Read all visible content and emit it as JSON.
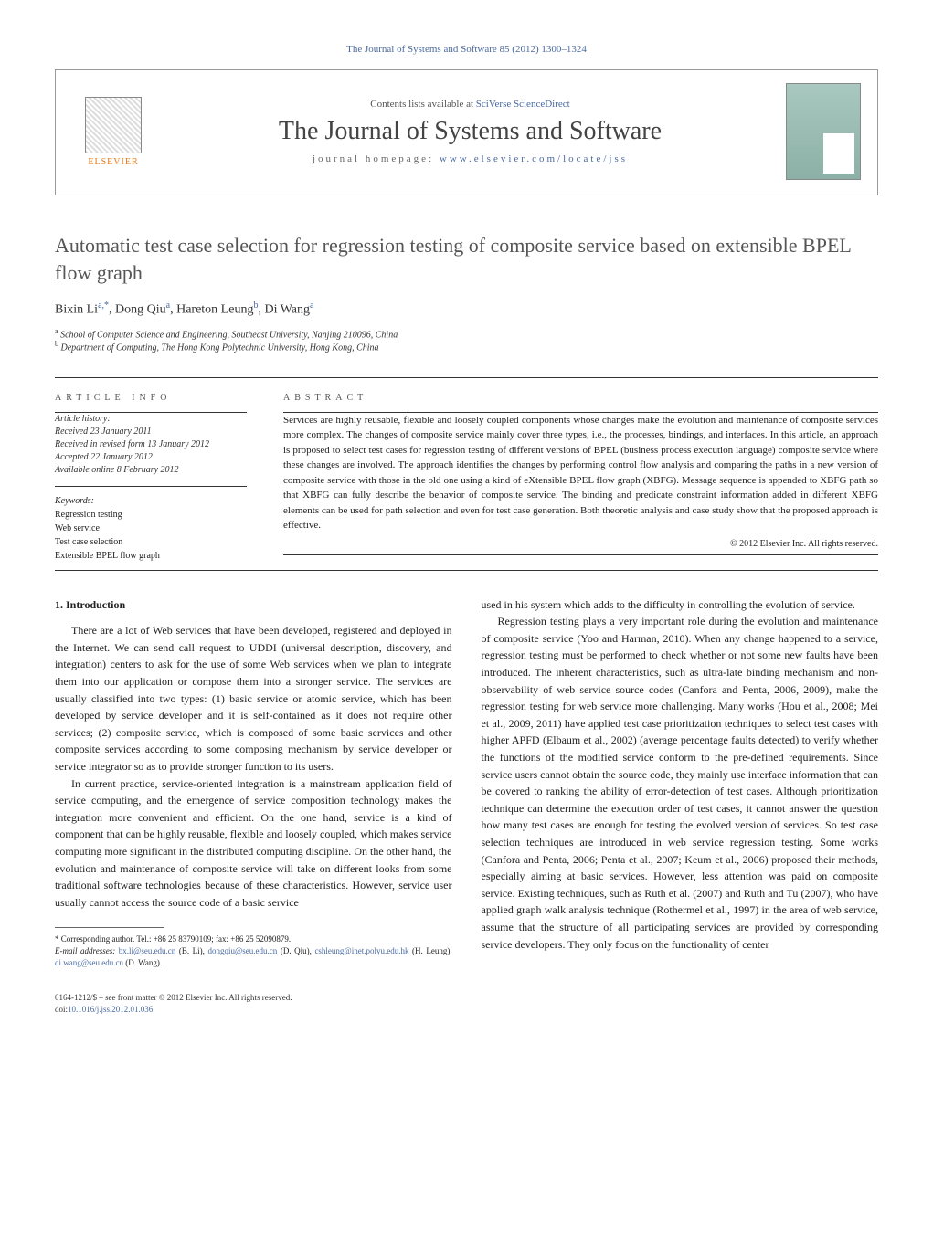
{
  "header": {
    "citation": "The Journal of Systems and Software 85 (2012) 1300–1324"
  },
  "journal_box": {
    "publisher_logo_text": "ELSEVIER",
    "contents_prefix": "Contents lists available at ",
    "contents_link": "SciVerse ScienceDirect",
    "journal_title": "The Journal of Systems and Software",
    "homepage_prefix": "journal homepage: ",
    "homepage_link": "www.elsevier.com/locate/jss"
  },
  "article": {
    "title": "Automatic test case selection for regression testing of composite service based on extensible BPEL flow graph",
    "authors_html": "Bixin Li",
    "author_list": [
      {
        "name": "Bixin Li",
        "sup": "a,*"
      },
      {
        "name": "Dong Qiu",
        "sup": "a"
      },
      {
        "name": "Hareton Leung",
        "sup": "b"
      },
      {
        "name": "Di Wang",
        "sup": "a"
      }
    ],
    "affiliations": [
      {
        "sup": "a",
        "text": "School of Computer Science and Engineering, Southeast University, Nanjing 210096, China"
      },
      {
        "sup": "b",
        "text": "Department of Computing, The Hong Kong Polytechnic University, Hong Kong, China"
      }
    ]
  },
  "info": {
    "article_info_label": "article info",
    "abstract_label": "abstract",
    "history_head": "Article history:",
    "history": [
      "Received 23 January 2011",
      "Received in revised form 13 January 2012",
      "Accepted 22 January 2012",
      "Available online 8 February 2012"
    ],
    "keywords_head": "Keywords:",
    "keywords": [
      "Regression testing",
      "Web service",
      "Test case selection",
      "Extensible BPEL flow graph"
    ],
    "abstract": "Services are highly reusable, flexible and loosely coupled components whose changes make the evolution and maintenance of composite services more complex. The changes of composite service mainly cover three types, i.e., the processes, bindings, and interfaces. In this article, an approach is proposed to select test cases for regression testing of different versions of BPEL (business process execution language) composite service where these changes are involved. The approach identifies the changes by performing control flow analysis and comparing the paths in a new version of composite service with those in the old one using a kind of eXtensible BPEL flow graph (XBFG). Message sequence is appended to XBFG path so that XBFG can fully describe the behavior of composite service. The binding and predicate constraint information added in different XBFG elements can be used for path selection and even for test case generation. Both theoretic analysis and case study show that the proposed approach is effective.",
    "copyright": "© 2012 Elsevier Inc. All rights reserved."
  },
  "body": {
    "section_heading": "1. Introduction",
    "p1": "There are a lot of Web services that have been developed, registered and deployed in the Internet. We can send call request to UDDI (universal description, discovery, and integration) centers to ask for the use of some Web services when we plan to integrate them into our application or compose them into a stronger service. The services are usually classified into two types: (1) basic service or atomic service, which has been developed by service developer and it is self-contained as it does not require other services; (2) composite service, which is composed of some basic services and other composite services according to some composing mechanism by service developer or service integrator so as to provide stronger function to its users.",
    "p2": "In current practice, service-oriented integration is a mainstream application field of service computing, and the emergence of service composition technology makes the integration more convenient and efficient. On the one hand, service is a kind of component that can be highly reusable, flexible and loosely coupled, which makes service computing more significant in the distributed computing discipline. On the other hand, the evolution and maintenance of composite service will take on different looks from some traditional software technologies because of these characteristics. However, service user usually cannot access the source code of a basic service",
    "p3": "used in his system which adds to the difficulty in controlling the evolution of service.",
    "p4": "Regression testing plays a very important role during the evolution and maintenance of composite service (Yoo and Harman, 2010). When any change happened to a service, regression testing must be performed to check whether or not some new faults have been introduced. The inherent characteristics, such as ultra-late binding mechanism and non-observability of web service source codes (Canfora and Penta, 2006, 2009), make the regression testing for web service more challenging. Many works (Hou et al., 2008; Mei et al., 2009, 2011) have applied test case prioritization techniques to select test cases with higher APFD (Elbaum et al., 2002) (average percentage faults detected) to verify whether the functions of the modified service conform to the pre-defined requirements. Since service users cannot obtain the source code, they mainly use interface information that can be covered to ranking the ability of error-detection of test cases. Although prioritization technique can determine the execution order of test cases, it cannot answer the question how many test cases are enough for testing the evolved version of services. So test case selection techniques are introduced in web service regression testing. Some works (Canfora and Penta, 2006; Penta et al., 2007; Keum et al., 2006) proposed their methods, especially aiming at basic services. However, less attention was paid on composite service. Existing techniques, such as Ruth et al. (2007) and Ruth and Tu (2007), who have applied graph walk analysis technique (Rothermel et al., 1997) in the area of web service, assume that the structure of all participating services are provided by corresponding service developers. They only focus on the functionality of center"
  },
  "footnotes": {
    "corresponding": "* Corresponding author. Tel.: +86 25 83790109; fax: +86 25 52090879.",
    "email_label": "E-mail addresses:",
    "emails": [
      {
        "email": "bx.li@seu.edu.cn",
        "who": "(B. Li)"
      },
      {
        "email": "dongqiu@seu.edu.cn",
        "who": "(D. Qiu)"
      },
      {
        "email": "cshleung@inet.polyu.edu.hk",
        "who": "(H. Leung)"
      },
      {
        "email": "di.wang@seu.edu.cn",
        "who": "(D. Wang)."
      }
    ]
  },
  "footline": {
    "line1": "0164-1212/$ – see front matter © 2012 Elsevier Inc. All rights reserved.",
    "doi_prefix": "doi:",
    "doi": "10.1016/j.jss.2012.01.036"
  }
}
